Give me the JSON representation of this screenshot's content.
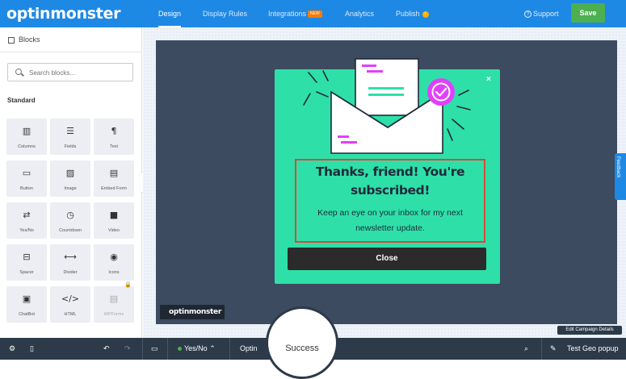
{
  "app": {
    "logo_text": "optinmonster"
  },
  "topbar": {
    "tabs": [
      {
        "label": "Design",
        "active": true
      },
      {
        "label": "Display Rules",
        "active": false
      },
      {
        "label": "Integrations",
        "badge": "NEW",
        "active": false
      },
      {
        "label": "Analytics",
        "active": false
      },
      {
        "label": "Publish",
        "badge": "!",
        "active": false
      }
    ],
    "support_label": "Support",
    "save_label": "Save"
  },
  "sidebar": {
    "title": "Blocks",
    "search_placeholder": "Search blocks...",
    "section_label": "Standard",
    "blocks": [
      {
        "label": "Columns",
        "icon": "columns-icon",
        "glyph": "▥"
      },
      {
        "label": "Fields",
        "icon": "fields-icon",
        "glyph": "☰"
      },
      {
        "label": "Text",
        "icon": "paragraph-icon",
        "glyph": "¶"
      },
      {
        "label": "Button",
        "icon": "button-icon",
        "glyph": "▭"
      },
      {
        "label": "Image",
        "icon": "image-icon",
        "glyph": "▨"
      },
      {
        "label": "Embed Form",
        "icon": "embed-form-icon",
        "glyph": "▤"
      },
      {
        "label": "Yes/No",
        "icon": "yes-no-icon",
        "glyph": "⇄"
      },
      {
        "label": "Countdown",
        "icon": "countdown-icon",
        "glyph": "◷"
      },
      {
        "label": "Video",
        "icon": "video-icon",
        "glyph": "■"
      },
      {
        "label": "Spacer",
        "icon": "spacer-icon",
        "glyph": "⊟"
      },
      {
        "label": "Divider",
        "icon": "divider-icon",
        "glyph": "⟷"
      },
      {
        "label": "Icons",
        "icon": "icons-icon",
        "glyph": "◉"
      },
      {
        "label": "ChatBot",
        "icon": "chatbot-icon",
        "glyph": "▣"
      },
      {
        "label": "HTML",
        "icon": "html-icon",
        "glyph": "</>"
      },
      {
        "label": "WPForms",
        "icon": "wpforms-icon",
        "glyph": "▤",
        "locked": true
      }
    ]
  },
  "popup": {
    "heading": "Thanks, friend! You're subscribed!",
    "message": "Keep an eye on your inbox for my next newsletter update.",
    "button_label": "Close",
    "close_glyph": "×",
    "footer_brand": "optinmonster",
    "bg_color": "#2ee0a8"
  },
  "feedback_label": "Feedback",
  "bottombar": {
    "view_label": "Yes/No",
    "optin_label": "Optin",
    "success_label": "Success",
    "tooltip": "Edit Campaign Details",
    "campaign_name": "Test Geo popup"
  }
}
